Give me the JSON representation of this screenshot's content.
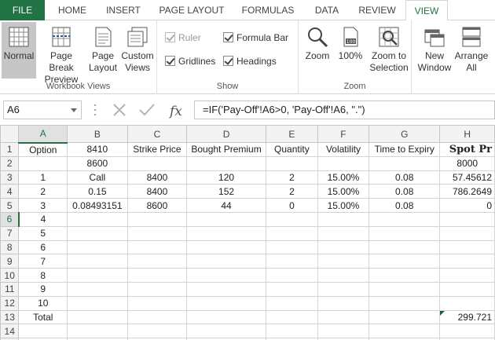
{
  "tabs": [
    "FILE",
    "HOME",
    "INSERT",
    "PAGE LAYOUT",
    "FORMULAS",
    "DATA",
    "REVIEW",
    "VIEW"
  ],
  "ribbon": {
    "workbook_views": {
      "label": "Workbook Views",
      "buttons": [
        {
          "label": "Normal",
          "icon": "normal-view-icon",
          "selected": true
        },
        {
          "label": "Page Break Preview",
          "icon": "page-break-icon"
        },
        {
          "label": "Page Layout",
          "icon": "page-layout-icon"
        },
        {
          "label": "Custom Views",
          "icon": "custom-views-icon"
        }
      ]
    },
    "show": {
      "label": "Show",
      "ruler": "Ruler",
      "gridlines": "Gridlines",
      "formula_bar": "Formula Bar",
      "headings": "Headings"
    },
    "zoom": {
      "label": "Zoom",
      "zoom": "Zoom",
      "hundred": "100%",
      "to_selection": "Zoom to Selection"
    },
    "window": {
      "new_window": "New Window",
      "arrange_all": "Arrange All"
    }
  },
  "formula_bar": {
    "name_box": "A6",
    "formula": "=IF('Pay-Off'!A6>0, 'Pay-Off'!A6, \".\")"
  },
  "grid": {
    "columns": [
      "A",
      "B",
      "C",
      "D",
      "E",
      "F",
      "G",
      "H"
    ],
    "rows": [
      [
        "Option",
        "8410",
        "Strike Price",
        "Bought Premium",
        "Quantity",
        "Volatility",
        "Time to Expiry",
        "Spot Pr"
      ],
      [
        "",
        "8600",
        "",
        "",
        "",
        "",
        "",
        "8000"
      ],
      [
        "1",
        "Call",
        "8400",
        "120",
        "2",
        "15.00%",
        "0.08",
        "57.45612"
      ],
      [
        "2",
        "0.15",
        "8400",
        "152",
        "2",
        "15.00%",
        "0.08",
        "786.2649"
      ],
      [
        "3",
        "0.08493151",
        "8600",
        "44",
        "0",
        "15.00%",
        "0.08",
        "0"
      ],
      [
        "4",
        "",
        "",
        "",
        "",
        "",
        "",
        ""
      ],
      [
        "5",
        "",
        "",
        "",
        "",
        "",
        "",
        ""
      ],
      [
        "6",
        "",
        "",
        "",
        "",
        "",
        "",
        ""
      ],
      [
        "7",
        "",
        "",
        "",
        "",
        "",
        "",
        ""
      ],
      [
        "8",
        "",
        "",
        "",
        "",
        "",
        "",
        ""
      ],
      [
        "9",
        "",
        "",
        "",
        "",
        "",
        "",
        ""
      ],
      [
        "10",
        "",
        "",
        "",
        "",
        "",
        "",
        ""
      ],
      [
        "Total",
        "",
        "",
        "",
        "",
        "",
        "",
        "299.721"
      ],
      [
        "",
        "",
        "",
        "",
        "",
        "",
        "",
        ""
      ],
      [
        "",
        "",
        "",
        "",
        "",
        "",
        "",
        ""
      ]
    ]
  }
}
